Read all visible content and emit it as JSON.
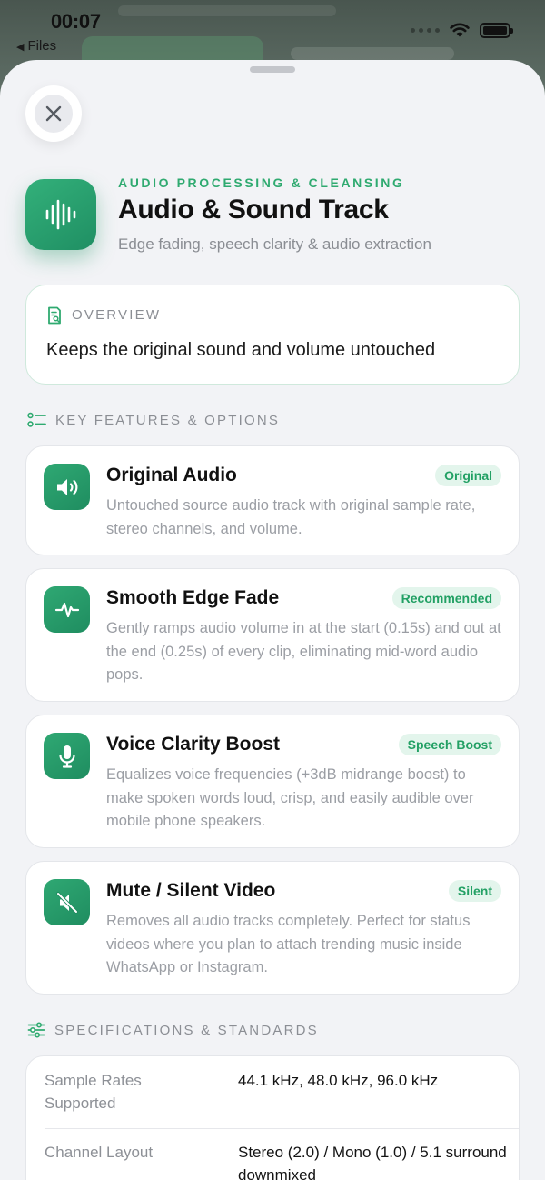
{
  "status_bar": {
    "time": "00:07",
    "back_app": "Files"
  },
  "sheet": {
    "eyebrow": "AUDIO PROCESSING & CLEANSING",
    "title": "Audio & Sound Track",
    "subtitle": "Edge fading, speech clarity & audio extraction",
    "overview": {
      "label": "OVERVIEW",
      "text": "Keeps the original sound and volume untouched"
    },
    "features_heading": "KEY FEATURES & OPTIONS",
    "features": [
      {
        "icon": "speaker-icon",
        "title": "Original Audio",
        "badge": "Original",
        "description": "Untouched source audio track with original sample rate, stereo channels, and volume."
      },
      {
        "icon": "waveform-pulse-icon",
        "title": "Smooth Edge Fade",
        "badge": "Recommended",
        "description": "Gently ramps audio volume in at the start (0.15s) and out at the end (0.25s) of every clip, eliminating mid-word audio pops."
      },
      {
        "icon": "microphone-icon",
        "title": "Voice Clarity Boost",
        "badge": "Speech Boost",
        "description": "Equalizes voice frequencies (+3dB midrange boost) to make spoken words loud, crisp, and easily audible over mobile phone speakers."
      },
      {
        "icon": "speaker-muted-icon",
        "title": "Mute / Silent Video",
        "badge": "Silent",
        "description": "Removes all audio tracks completely. Perfect for status videos where you plan to attach trending music inside WhatsApp or Instagram."
      }
    ],
    "specs_heading": "SPECIFICATIONS & STANDARDS",
    "specs": [
      {
        "key": "Sample Rates Supported",
        "value": "44.1 kHz, 48.0 kHz, 96.0 kHz"
      },
      {
        "key": "Channel Layout",
        "value": "Stereo (2.0) / Mono (1.0) / 5.1 surround downmixed"
      }
    ]
  },
  "colors": {
    "accent": "#2faa70",
    "badge_bg": "#e3f5ec",
    "sheet_bg": "#f2f3f6"
  }
}
